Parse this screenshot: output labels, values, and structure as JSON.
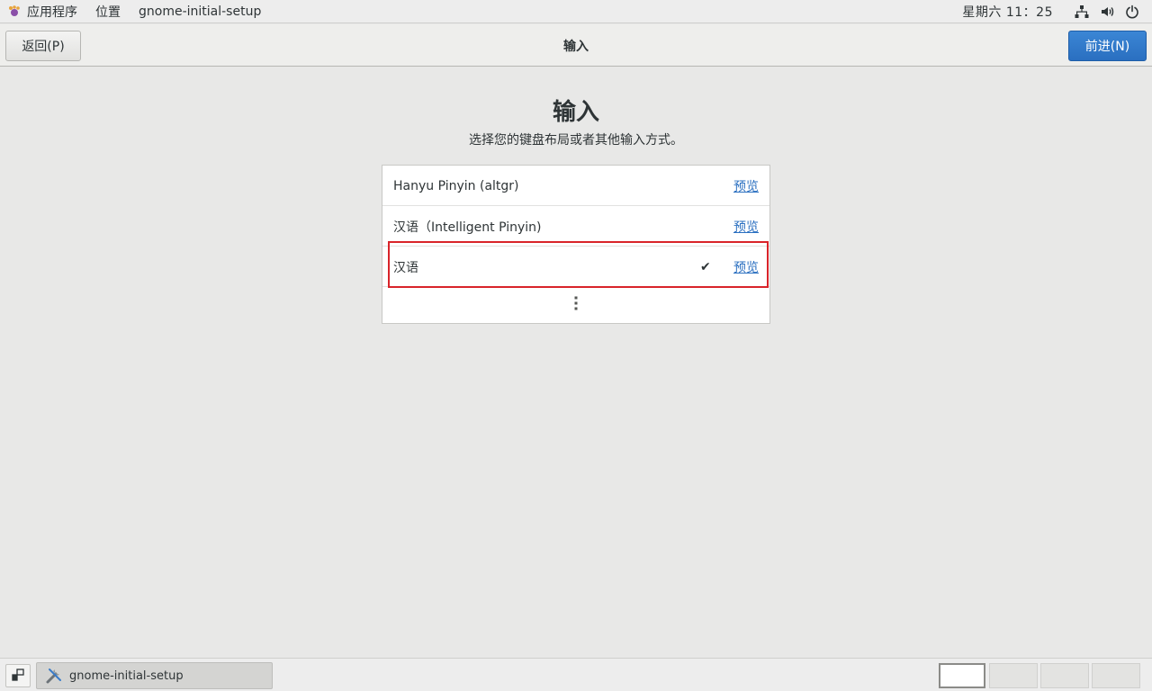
{
  "top_panel": {
    "apps_menu": "应用程序",
    "places_menu": "位置",
    "app_name": "gnome-initial-setup",
    "clock": "星期六 11：25"
  },
  "header": {
    "back_label": "返回(P)",
    "title": "输入",
    "next_label": "前进(N)"
  },
  "main": {
    "heading": "输入",
    "subtitle": "选择您的键盘布局或者其他输入方式。",
    "preview_label": "预览",
    "inputs": [
      {
        "label": "Hanyu Pinyin (altgr)",
        "selected": false
      },
      {
        "label": "汉语（Intelligent Pinyin)",
        "selected": false
      },
      {
        "label": "汉语",
        "selected": true
      }
    ]
  },
  "taskbar": {
    "window_title": "gnome-initial-setup",
    "workspaces": 4,
    "active_workspace": 1
  }
}
